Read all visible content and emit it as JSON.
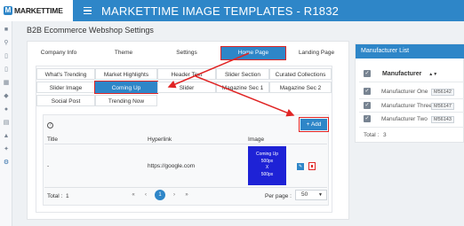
{
  "header": {
    "logo_mark": "M",
    "logo_text": "MARKETTIME",
    "title": "MARKETTIME IMAGE TEMPLATES - R1832"
  },
  "rail": {
    "icons": [
      "dashboard-icon",
      "search-icon",
      "document-icon",
      "document-icon",
      "building-icon",
      "tag-icon",
      "users-icon",
      "table-icon",
      "chart-icon",
      "wrench-icon",
      "gears-icon"
    ]
  },
  "page": {
    "heading": "B2B Ecommerce Webshop Settings"
  },
  "main_tabs": [
    {
      "label": "Company Info"
    },
    {
      "label": "Theme"
    },
    {
      "label": "Settings"
    },
    {
      "label": "Home Page"
    },
    {
      "label": "Landing Page"
    }
  ],
  "inner_tabs": [
    {
      "label": "What's Trending"
    },
    {
      "label": "Market Highlights"
    },
    {
      "label": "Header Text"
    },
    {
      "label": "Slider Section"
    },
    {
      "label": "Curated Collections"
    },
    {
      "label": "Slider Image"
    },
    {
      "label": "Coming Up"
    },
    {
      "label": "Slider"
    },
    {
      "label": "Magazine Sec 1"
    },
    {
      "label": "Magazine Sec 2"
    },
    {
      "label": "Social Post"
    },
    {
      "label": "Trending Now"
    }
  ],
  "table": {
    "help_label": "?",
    "add_label": "+ Add",
    "columns": [
      "Title",
      "Hyperlink",
      "Image"
    ],
    "row": {
      "title": "-",
      "hyperlink": "https://google.com",
      "image_line1": "Coming Up",
      "image_line2": "500px",
      "image_line3": "X",
      "image_line4": "500px"
    },
    "total_label": "Total :",
    "total_value": "1",
    "pager": [
      "«",
      "‹",
      "1",
      "›",
      "»"
    ],
    "per_page_label": "Per page :",
    "per_page_value": "50"
  },
  "manufacturer_panel": {
    "title": "Manufacturer List",
    "column": "Manufacturer",
    "items": [
      {
        "name": "Manufacturer One",
        "code": "M56142"
      },
      {
        "name": "Manufacturer Three",
        "code": "M56147"
      },
      {
        "name": "Manufacturer Two",
        "code": "M56143"
      }
    ],
    "total_label": "Total :",
    "total_value": "3"
  },
  "colors": {
    "accent": "#2e86c8",
    "highlight": "#e02424",
    "thumb": "#1e22d6"
  }
}
